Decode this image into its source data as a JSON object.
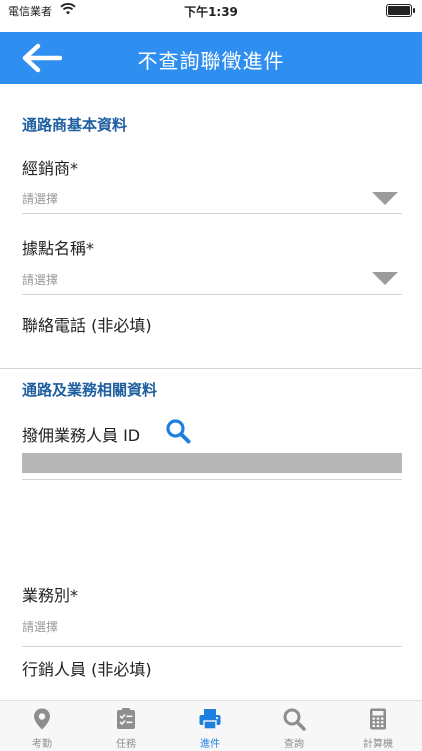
{
  "status_bar": {
    "carrier": "電信業者",
    "time": "下午1:39"
  },
  "header": {
    "title": "不查詢聯徵進件"
  },
  "sections": {
    "dealer_info": {
      "title": "通路商基本資料"
    },
    "business_info": {
      "title": "通路及業務相關資料"
    }
  },
  "fields": {
    "dealer": {
      "label": "經銷商*",
      "value": "請選擇"
    },
    "site_name": {
      "label": "據點名稱*",
      "value": "請選擇"
    },
    "contact_phone": {
      "label": "聯絡電話 (非必填)",
      "value": ""
    },
    "commission_staff_id": {
      "label": "撥佣業務人員 ID"
    },
    "business_type": {
      "label": "業務別*",
      "value": "請選擇"
    },
    "marketing_staff": {
      "label": "行銷人員 (非必填)"
    }
  },
  "tabs": [
    {
      "label": "考勤",
      "icon": "location-pin-icon",
      "active": false
    },
    {
      "label": "任務",
      "icon": "checklist-icon",
      "active": false
    },
    {
      "label": "進件",
      "icon": "printer-icon",
      "active": true
    },
    {
      "label": "查詢",
      "icon": "search-icon",
      "active": false
    },
    {
      "label": "計算機",
      "icon": "calculator-icon",
      "active": false
    }
  ],
  "colors": {
    "header_bg": "#2f8ff0",
    "section_title": "#1f5fa0",
    "active_tab": "#1e7fde",
    "inactive_tab": "#8e8e8e"
  }
}
